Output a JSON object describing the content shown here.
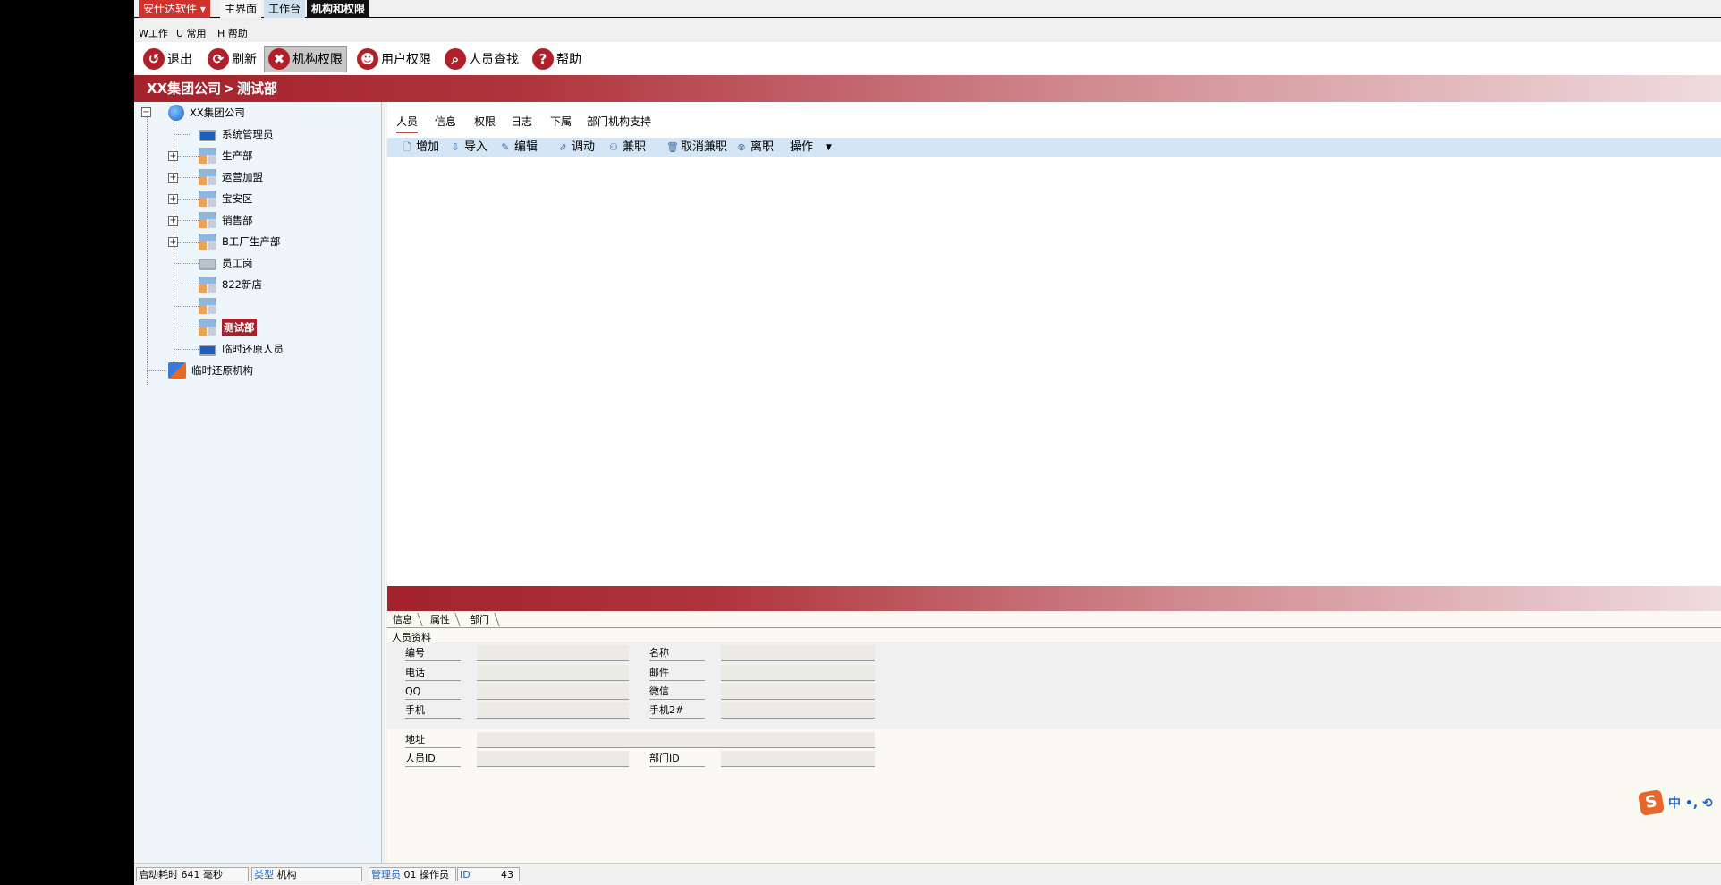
{
  "topbar": {
    "brand": "安仕达软件",
    "tabs": [
      "主界面",
      "工作台",
      "机构和权限"
    ]
  },
  "menu": [
    "W工作",
    "U 常用",
    "H 帮助"
  ],
  "toolbar": [
    {
      "label": "退出",
      "icon": "exit-icon"
    },
    {
      "label": "刷新",
      "icon": "refresh-icon"
    },
    {
      "label": "机构权限",
      "icon": "tools-icon"
    },
    {
      "label": "用户权限",
      "icon": "user-icon"
    },
    {
      "label": "人员查找",
      "icon": "search-icon"
    },
    {
      "label": "帮助",
      "icon": "help-icon"
    }
  ],
  "breadcrumb": {
    "root": "XX集团公司",
    "sep": ">",
    "current": "测试部"
  },
  "tree": {
    "root": "XX集团公司",
    "children": [
      "系统管理员",
      "生产部",
      "运营加盟",
      "宝安区",
      "销售部",
      "B工厂生产部",
      "员工岗",
      "822新店",
      "",
      "测试部",
      "临时还原人员"
    ],
    "root2": "临时还原机构"
  },
  "tabs": [
    "人员",
    "信息",
    "权限",
    "日志",
    "下属",
    "部门机构支持"
  ],
  "ops": [
    "增加",
    "导入",
    "编辑",
    "调动",
    "兼职",
    "取消兼职",
    "离职",
    "操作"
  ],
  "bottom_tabs": [
    "信息",
    "属性",
    "部门"
  ],
  "section_title": "人员资料",
  "form": {
    "id": "编号",
    "name": "名称",
    "phone": "电话",
    "email": "邮件",
    "qq": "QQ",
    "wechat": "微信",
    "mobile": "手机",
    "mobile2": "手机2#",
    "address": "地址",
    "person_id": "人员ID",
    "dept_id": "部门ID"
  },
  "ime": {
    "logo": "S",
    "text": "中 •, ⟲"
  },
  "status": {
    "startup_key": "启动耗时",
    "startup_val": "641 毫秒",
    "type_key": "类型",
    "type_val": "机构",
    "admin_key": "管理员",
    "admin_val": "01 操作员",
    "id_key": "ID",
    "id_val": "43"
  },
  "colors": {
    "accent": "#a3222b",
    "brand": "#d0312d",
    "toolbar_blue": "#d4e6f5"
  }
}
